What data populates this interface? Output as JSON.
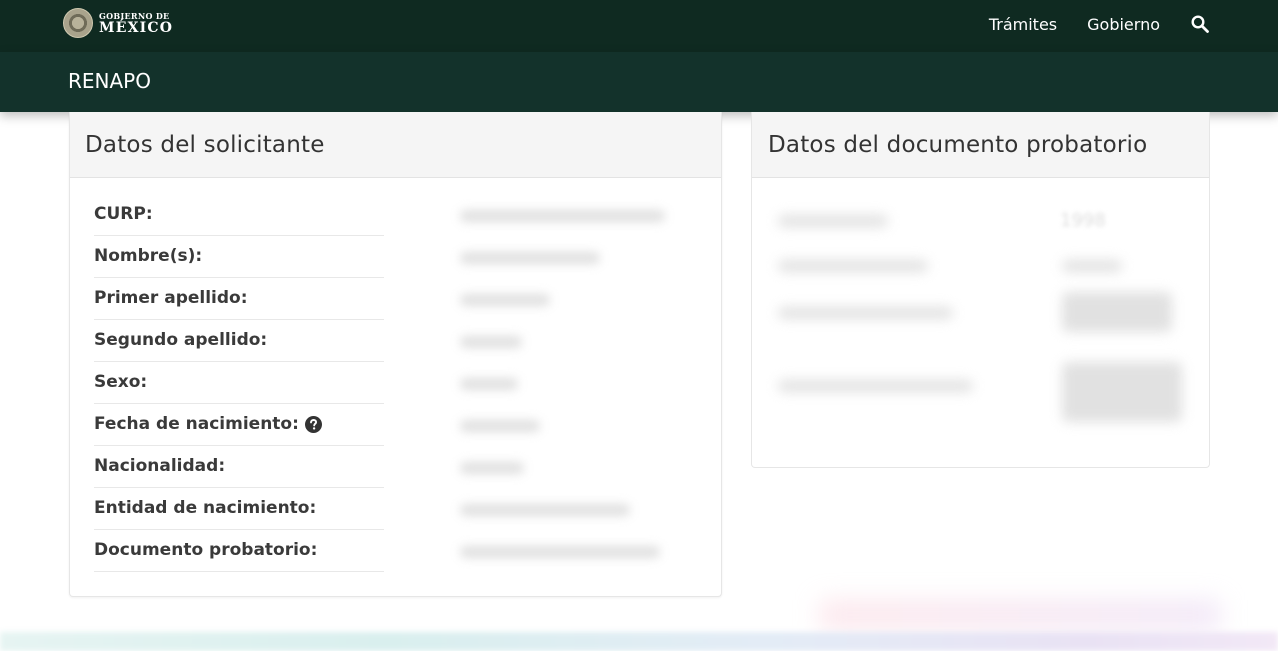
{
  "header": {
    "logo": {
      "line1": "GOBIERNO DE",
      "line2": "MÉXICO"
    },
    "nav": [
      "Trámites",
      "Gobierno"
    ],
    "search_icon": "search-icon"
  },
  "subheader": {
    "title": "RENAPO"
  },
  "solicitante": {
    "title": "Datos del solicitante",
    "fields": [
      {
        "label": "CURP:"
      },
      {
        "label": "Nombre(s):"
      },
      {
        "label": "Primer apellido:"
      },
      {
        "label": "Segundo apellido:"
      },
      {
        "label": "Sexo:"
      },
      {
        "label": "Fecha de nacimiento:",
        "help_icon": "question-circle-icon"
      },
      {
        "label": "Nacionalidad:"
      },
      {
        "label": "Entidad de nacimiento:"
      },
      {
        "label": "Documento probatorio:"
      }
    ]
  },
  "documento": {
    "title": "Datos del documento probatorio",
    "year_value": "1998"
  },
  "colors": {
    "header_bg": "#0f2a21",
    "subheader_bg": "#13322b",
    "panel_heading_bg": "#f5f5f5"
  }
}
